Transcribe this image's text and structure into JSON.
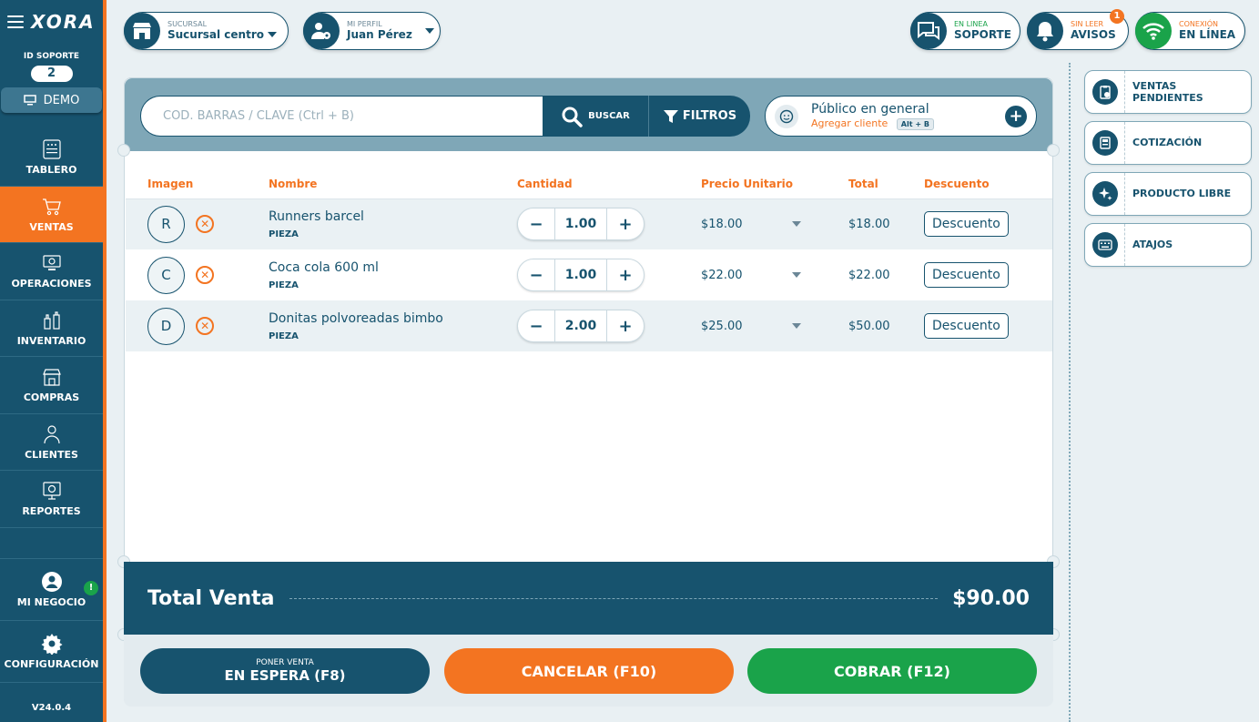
{
  "app": {
    "brand": "XORA",
    "version": "V24.0.4"
  },
  "sidebar": {
    "support_label": "ID SOPORTE",
    "support_id": "2",
    "demo_label": "DEMO",
    "items": [
      {
        "label": "TABLERO",
        "icon": "dashboard-icon"
      },
      {
        "label": "VENTAS",
        "icon": "cart-icon",
        "active": true
      },
      {
        "label": "OPERACIONES",
        "icon": "operations-icon"
      },
      {
        "label": "INVENTARIO",
        "icon": "inventory-icon"
      },
      {
        "label": "COMPRAS",
        "icon": "store-icon"
      },
      {
        "label": "CLIENTES",
        "icon": "clients-icon"
      },
      {
        "label": "REPORTES",
        "icon": "reports-icon"
      }
    ],
    "bottom": [
      {
        "label": "MI NEGOCIO",
        "icon": "user-circle-icon",
        "badge": "!"
      },
      {
        "label": "CONFIGURACIÓN",
        "icon": "gear-icon"
      }
    ]
  },
  "topbar": {
    "branch": {
      "small": "SUCURSAL",
      "big": "Sucursal centro"
    },
    "profile": {
      "small": "MI PERFIL",
      "big": "Juan Pérez"
    },
    "support": {
      "small": "EN LINEA",
      "big": "SOPORTE"
    },
    "notices": {
      "small": "SIN LEER",
      "big": "AVISOS",
      "count": "1"
    },
    "connection": {
      "small": "CONEXIÓN",
      "big": "EN LÍNEA"
    }
  },
  "search": {
    "placeholder": "CÓD. BARRAS / CLAVE (Ctrl + B)",
    "search_label": "BUSCAR",
    "filters_label": "FILTROS"
  },
  "client": {
    "name": "Público en general",
    "add_label": "Agregar cliente",
    "shortcut": "Alt + B"
  },
  "table": {
    "headers": [
      "Imagen",
      "Nombre",
      "Cantidad",
      "Precio Unitario",
      "Total",
      "Descuento"
    ],
    "rows": [
      {
        "initial": "R",
        "name": "Runners barcel",
        "unit": "PIEZA",
        "qty": "1.00",
        "price": "$18.00",
        "total": "$18.00",
        "discount": "Descuento"
      },
      {
        "initial": "C",
        "name": "Coca cola 600 ml",
        "unit": "PIEZA",
        "qty": "1.00",
        "price": "$22.00",
        "total": "$22.00",
        "discount": "Descuento"
      },
      {
        "initial": "D",
        "name": "Donitas polvoreadas bimbo",
        "unit": "PIEZA",
        "qty": "2.00",
        "price": "$25.00",
        "total": "$50.00",
        "discount": "Descuento"
      }
    ]
  },
  "totals": {
    "label": "Total Venta",
    "value": "$90.00"
  },
  "actions": {
    "hold_small": "PONER VENTA",
    "hold_big": "EN ESPERA (F8)",
    "cancel": "CANCELAR (F10)",
    "pay": "COBRAR (F12)"
  },
  "right_panel": [
    {
      "label": "VENTAS PENDIENTES",
      "icon": "clipboard-clock-icon"
    },
    {
      "label": "COTIZACIÓN",
      "icon": "register-icon"
    },
    {
      "label": "PRODUCTO LIBRE",
      "icon": "sparkle-icon"
    },
    {
      "label": "ATAJOS",
      "icon": "keyboard-icon"
    }
  ],
  "colors": {
    "primary": "#17536e",
    "accent": "#f37421",
    "success": "#1aa34a"
  }
}
